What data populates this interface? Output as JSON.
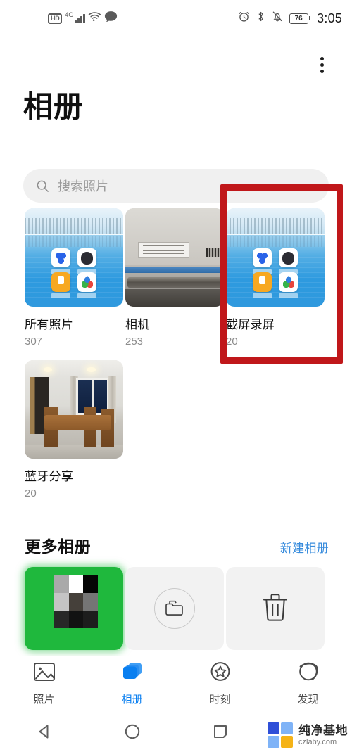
{
  "statusbar": {
    "hd_label": "HD",
    "network_label": "4G",
    "icons_left": [
      "hd-icon",
      "signal-bars-icon",
      "wifi-icon",
      "message-bubble-icon"
    ],
    "icons_right": [
      "alarm-clock-icon",
      "bluetooth-icon",
      "mute-bell-icon",
      "battery-icon"
    ],
    "battery_level": "76",
    "time": "3:05"
  },
  "header": {
    "title": "相册",
    "overflow_menu": "more-options-icon"
  },
  "search": {
    "placeholder": "搜索照片",
    "icon": "search-icon"
  },
  "albums": [
    {
      "name": "所有照片",
      "count": "307",
      "thumb": "home-screen-screenshot"
    },
    {
      "name": "相机",
      "count": "253",
      "thumb": "machinery-photo"
    },
    {
      "name": "截屏录屏",
      "count": "20",
      "thumb": "home-screen-screenshot",
      "highlighted": true
    },
    {
      "name": "蓝牙分享",
      "count": "20",
      "thumb": "room-photo"
    }
  ],
  "more_albums": {
    "title": "更多相册",
    "new_album_label": "新建相册",
    "tiles": [
      {
        "name": "wechat-thumbnail",
        "icon": ""
      },
      {
        "name": "new-folder-tile",
        "icon": "folder-icon"
      },
      {
        "name": "trash-tile",
        "icon": "trash-icon"
      }
    ]
  },
  "tabbar": {
    "items": [
      {
        "label": "照片",
        "icon": "photo-icon",
        "active": false
      },
      {
        "label": "相册",
        "icon": "albums-icon",
        "active": true
      },
      {
        "label": "时刻",
        "icon": "star-circle-icon",
        "active": false
      },
      {
        "label": "发现",
        "icon": "discover-icon",
        "active": false
      }
    ]
  },
  "navbar": {
    "back": "back-triangle-icon",
    "home": "home-circle-icon",
    "recents": "recents-square-icon"
  },
  "watermark": {
    "title": "纯净基地",
    "subtitle": "czlaby.com"
  },
  "colors": {
    "accent_blue": "#0a7ff0",
    "link_blue": "#3a8ddd",
    "annotation_red": "#c0171a",
    "wechat_green": "#1fb83d",
    "search_bg": "#f0f0f0",
    "tile_bg": "#f2f2f2"
  }
}
